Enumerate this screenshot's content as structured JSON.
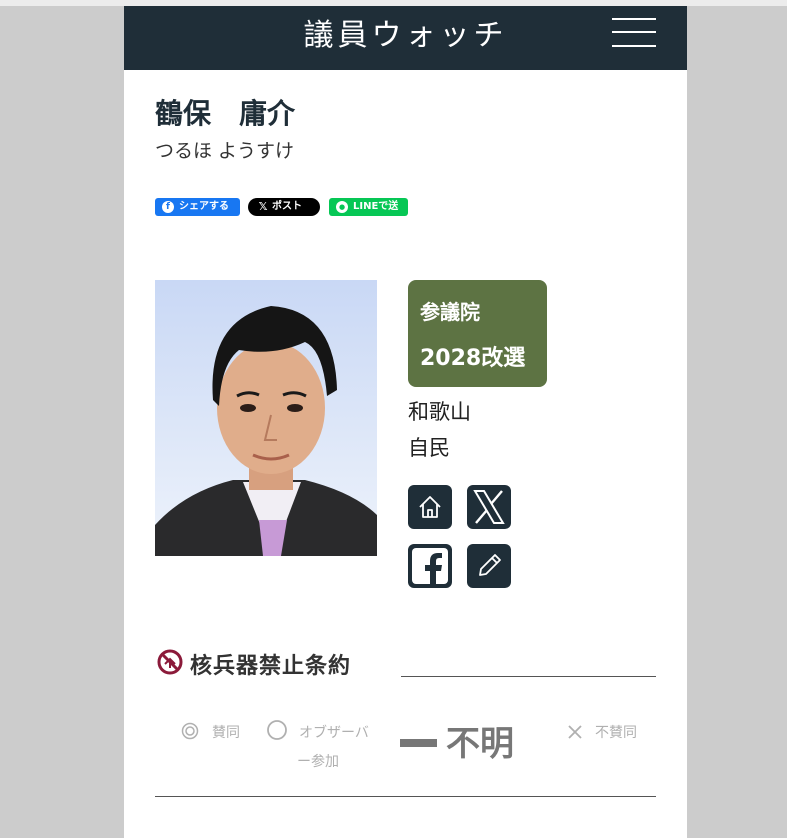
{
  "header": {
    "logo": "議員ウォッチ",
    "menu_icon": "hamburger-icon"
  },
  "profile": {
    "name": "鶴保　庸介",
    "kana": "つるほ ようすけ",
    "chamber": "参議院",
    "term": "2028改選",
    "prefecture": "和歌山",
    "party": "自民",
    "photo_icon": "portrait-photo"
  },
  "share": {
    "facebook": "シェアする",
    "x": "ポスト",
    "line": "LINEで送る"
  },
  "links": [
    "home-icon",
    "x-icon",
    "facebook-icon",
    "pencil-icon"
  ],
  "topic": {
    "title": "核兵器禁止条約",
    "icon": "nuclear-ban-icon",
    "options": {
      "agree": "賛同",
      "observer_line1": "オブザーバ",
      "observer_line2": "ー参加",
      "disagree": "不賛同"
    },
    "result": "不明"
  },
  "colors": {
    "header_bg": "#1f2e38",
    "badge_bg": "#5d7343",
    "accent": "#8b1a3a"
  }
}
